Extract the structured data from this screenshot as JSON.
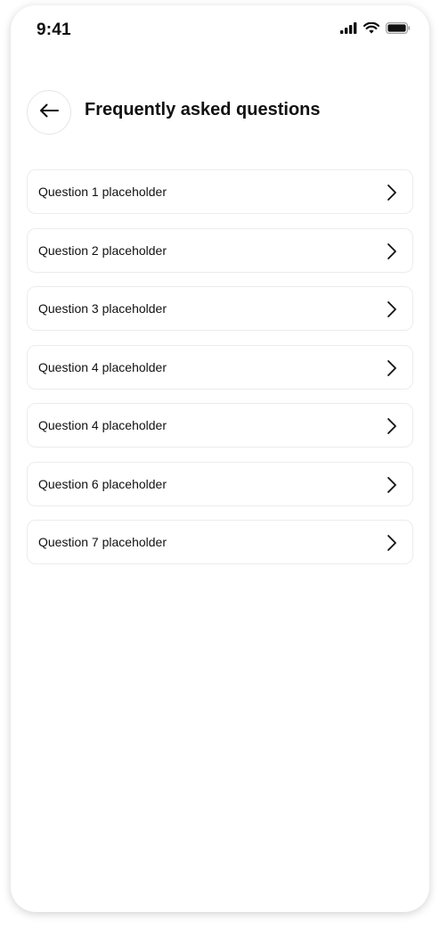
{
  "status_bar": {
    "time": "9:41",
    "icons": [
      "signal-icon",
      "wifi-icon",
      "battery-icon"
    ]
  },
  "header": {
    "back_icon": "arrow-left-icon",
    "title": "Frequently asked questions"
  },
  "faq": {
    "chevron_icon": "chevron-right-icon",
    "items": [
      {
        "label": "Question 1 placeholder"
      },
      {
        "label": "Question 2 placeholder"
      },
      {
        "label": "Question 3 placeholder"
      },
      {
        "label": "Question 4 placeholder"
      },
      {
        "label": "Question 4 placeholder"
      },
      {
        "label": "Question 6 placeholder"
      },
      {
        "label": "Question 7 placeholder"
      }
    ]
  },
  "colors": {
    "text": "#111111",
    "card_border": "#ececec",
    "background": "#ffffff"
  }
}
